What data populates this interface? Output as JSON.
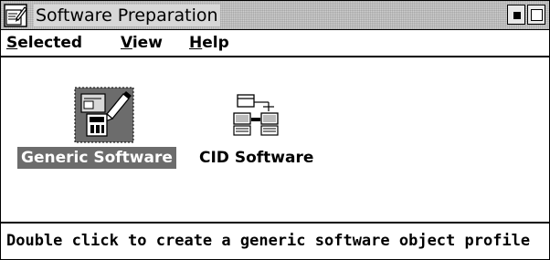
{
  "window": {
    "title": "Software Preparation",
    "sysmenu_icon": "system-menu-icon",
    "minimize_icon": "minimize-icon",
    "maximize_icon": "maximize-icon"
  },
  "menubar": {
    "items": [
      {
        "mnemonic": "S",
        "rest": "elected"
      },
      {
        "mnemonic": "V",
        "rest": "iew"
      },
      {
        "mnemonic": "H",
        "rest": "elp"
      }
    ]
  },
  "objects": [
    {
      "label": "Generic Software",
      "icon": "generic-software-icon",
      "selected": true
    },
    {
      "label": "CID Software",
      "icon": "cid-software-icon",
      "selected": false
    }
  ],
  "status": {
    "text": "Double click to create a generic software object profile"
  },
  "colors": {
    "selection_bg": "#6c6c6c",
    "selection_fg": "#ffffff",
    "titlebar_bg": "#cfcfcf"
  }
}
